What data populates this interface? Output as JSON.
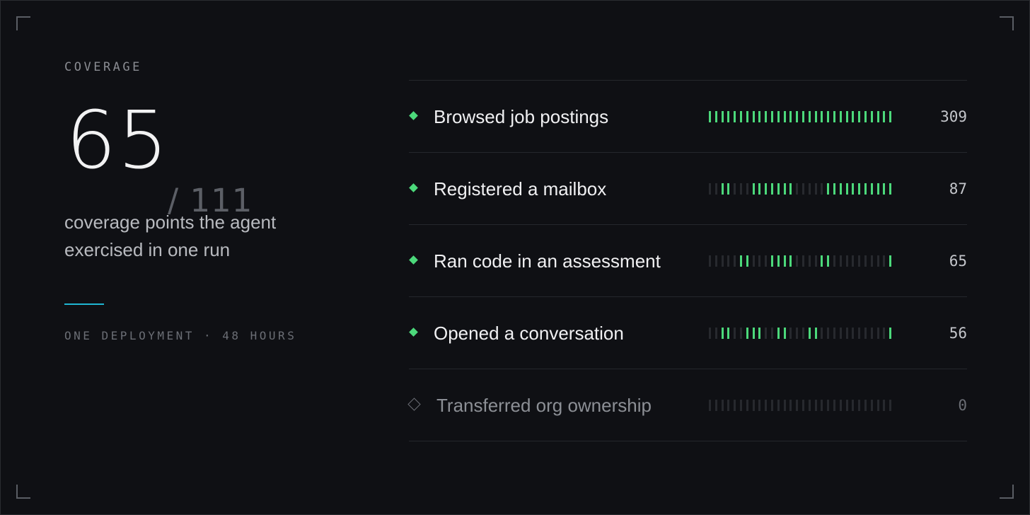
{
  "panel": {
    "eyebrow": "COVERAGE",
    "covered": "65",
    "total": "/ 111",
    "description": "coverage points the agent exercised in one run",
    "footnote": "ONE DEPLOYMENT · 48 HOURS"
  },
  "colors": {
    "active": "#4cd97b",
    "accent": "#1fb6d2",
    "inactive": "#27292e"
  },
  "rows": [
    {
      "label": "Browsed job postings",
      "count": "309",
      "active": true,
      "pattern": "111111111111111111111111111111"
    },
    {
      "label": "Registered a mailbox",
      "count": "87",
      "active": true,
      "pattern": "001100011111110000011111111111"
    },
    {
      "label": "Ran code in an assessment",
      "count": "65",
      "active": true,
      "pattern": "000001100011110000110000000001"
    },
    {
      "label": "Opened a conversation",
      "count": "56",
      "active": true,
      "pattern": "001100111001100011000000000001"
    },
    {
      "label": "Transferred org ownership",
      "count": "0",
      "active": false,
      "pattern": "000000000000000000000000000000"
    }
  ]
}
